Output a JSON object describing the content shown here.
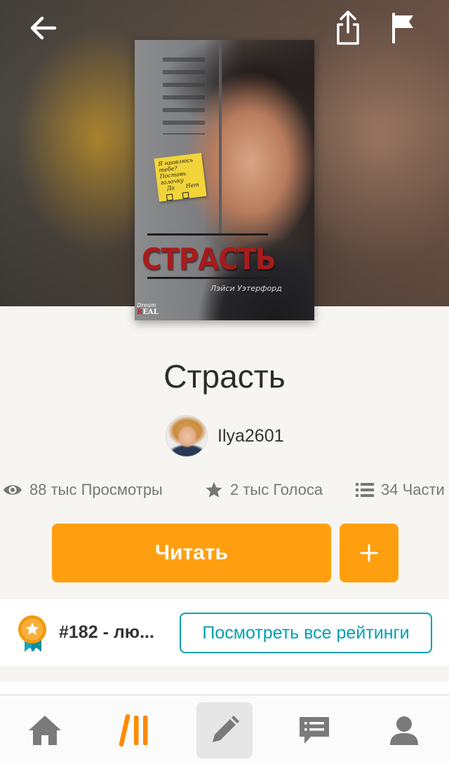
{
  "header": {
    "back_icon": "arrow-left-icon",
    "share_icon": "share-icon",
    "report_icon": "flag-icon"
  },
  "cover": {
    "note_line1": "Я нравлюсь тебе?",
    "note_line2": "Поставь галочку",
    "note_yes": "Да",
    "note_no": "Нет",
    "title": "СТРАСТЬ",
    "author": "Лэйси Уэтерфорд",
    "publisher_line1": "Dream",
    "publisher_line2": "REAL"
  },
  "story": {
    "title": "Страсть",
    "author": "Ilya2601"
  },
  "stats": {
    "views": "88 тыс Просмотры",
    "votes": "2 тыс Голоса",
    "parts": "34 Части"
  },
  "actions": {
    "read_label": "Читать",
    "add_label": "+"
  },
  "ranking": {
    "number": "#182",
    "separator": " - ",
    "category": "лю...",
    "all_rankings_label": "Посмотреть все рейтинги"
  },
  "nav": {
    "items": [
      "home-icon",
      "library-icon",
      "write-icon",
      "messages-icon",
      "profile-icon"
    ],
    "active": "write-icon"
  },
  "colors": {
    "accent": "#ff9f0f",
    "teal": "#00a0b0",
    "library_orange": "#ff8a00",
    "icon_gray": "#7a7a7a"
  }
}
